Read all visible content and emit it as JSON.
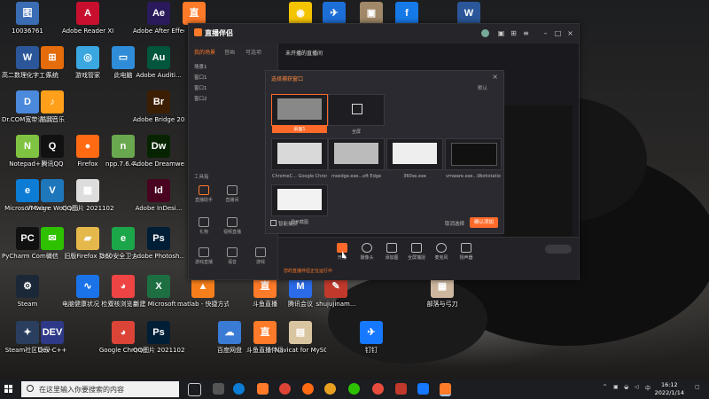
{
  "desktop_icons": [
    {
      "id": "10036761",
      "label": "10036761",
      "color": "#3b6db5",
      "glyph": "图"
    },
    {
      "id": "adobe-reader",
      "label": "Adobe Reader XI",
      "color": "#c8102e",
      "glyph": "A"
    },
    {
      "id": "after-effects",
      "label": "Adobe After Effects 2020",
      "color": "#2b1a5b",
      "glyph": "Ae"
    },
    {
      "id": "app-orange-top",
      "label": "",
      "color": "#ff7a29",
      "glyph": "直"
    },
    {
      "id": "app-yellow-top",
      "label": "",
      "color": "#f5c400",
      "glyph": "◉"
    },
    {
      "id": "app-bird-top",
      "label": "",
      "color": "#1d6fd8",
      "glyph": "✈"
    },
    {
      "id": "app-doc-top",
      "label": "",
      "color": "#a08868",
      "glyph": "▣"
    },
    {
      "id": "app-flash-top",
      "label": "",
      "color": "#1679e8",
      "glyph": "f"
    },
    {
      "id": "word-top",
      "label": "",
      "color": "#2b579a",
      "glyph": "W"
    },
    {
      "id": "word-doc",
      "label": "高二数理化字工作总结.d...",
      "color": "#2b579a",
      "glyph": "W"
    },
    {
      "id": "tool-grid",
      "label": "系统",
      "color": "#e46c0a",
      "glyph": "⊞"
    },
    {
      "id": "game-helper",
      "label": "游戏管家",
      "color": "#3aa7e0",
      "glyph": "◎"
    },
    {
      "id": "this-pc",
      "label": "此电脑",
      "color": "#2f8cd8",
      "glyph": "▭"
    },
    {
      "id": "audition",
      "label": "Adobe Auditi...",
      "color": "#00553d",
      "glyph": "Au"
    },
    {
      "id": "com-auth",
      "label": "Dr.COM宽带认证客户端",
      "color": "#4a89dc",
      "glyph": "D"
    },
    {
      "id": "music",
      "label": "酷我音乐",
      "color": "#ff9f1a",
      "glyph": "♪"
    },
    {
      "id": "bridge",
      "label": "Adobe Bridge 2020",
      "color": "#3c1e02",
      "glyph": "Br"
    },
    {
      "id": "notepadpp",
      "label": "Notepad++",
      "color": "#80c342",
      "glyph": "N"
    },
    {
      "id": "qq",
      "label": "腾讯QQ",
      "color": "#111",
      "glyph": "Q"
    },
    {
      "id": "firefox",
      "label": "Firefox",
      "color": "#ff6a13",
      "glyph": "●"
    },
    {
      "id": "npp764",
      "label": "npp.7.6.4...",
      "color": "#6aa84f",
      "glyph": "n"
    },
    {
      "id": "dreamweaver",
      "label": "Adobe Dreamwe...",
      "color": "#072401",
      "glyph": "Dw"
    },
    {
      "id": "edge",
      "label": "Microsoft Edge",
      "color": "#0c7cd5",
      "glyph": "e"
    },
    {
      "id": "vmware",
      "label": "VMware Workstati...",
      "color": "#1f77bb",
      "glyph": "V"
    },
    {
      "id": "qq-img",
      "label": "QQ图片 20211020...",
      "color": "#ddd",
      "glyph": "▦"
    },
    {
      "id": "indesign",
      "label": "Adobe InDesi...",
      "color": "#49021f",
      "glyph": "Id"
    },
    {
      "id": "pycharm",
      "label": "PyCharm Communi...",
      "color": "#111",
      "glyph": "PC"
    },
    {
      "id": "wechat",
      "label": "微信",
      "color": "#2dc100",
      "glyph": "✉"
    },
    {
      "id": "firefox-profile",
      "label": "旧版Firefox 数据",
      "color": "#e5b84c",
      "glyph": "▰"
    },
    {
      "id": "pc-manager",
      "label": "360安全卫士 ...",
      "color": "#1ca64a",
      "glyph": "e"
    },
    {
      "id": "photoshop",
      "label": "Adobe Photosh...",
      "color": "#001e36",
      "glyph": "Ps"
    },
    {
      "id": "steam",
      "label": "Steam",
      "color": "#1b2838",
      "glyph": "⚙"
    },
    {
      "id": "pc-monitor",
      "label": "电脑健康状况 检查",
      "color": "#1a73e8",
      "glyph": "∿"
    },
    {
      "id": "chrome-dual",
      "label": "双核浏览器",
      "color": "#e44",
      "glyph": "◕"
    },
    {
      "id": "excel-new",
      "label": "新建 Microsoft ...",
      "color": "#1d6f42",
      "glyph": "X"
    },
    {
      "id": "matlab",
      "label": "matlab - 快捷方式",
      "color": "#f77f1b",
      "glyph": "▲"
    },
    {
      "id": "live-app",
      "label": "斗鱼直播",
      "color": "#ff7a29",
      "glyph": "直"
    },
    {
      "id": "tencent-meeting",
      "label": "腾讯会议",
      "color": "#2b6ae8",
      "glyph": "M"
    },
    {
      "id": "shujujinam",
      "label": "shujujinam...",
      "color": "#c0392b",
      "glyph": "✎"
    },
    {
      "id": "photo-wall",
      "label": "部落与弓刀",
      "color": "#cdb79e",
      "glyph": "▦"
    },
    {
      "id": "steam-support",
      "label": "Steam社区管家",
      "color": "#2a3f5f",
      "glyph": "✦"
    },
    {
      "id": "devcpp",
      "label": "Dev-C++",
      "color": "#2e3a87",
      "glyph": "DEV"
    },
    {
      "id": "chrome",
      "label": "Google Chrome",
      "color": "#db4437",
      "glyph": "◕"
    },
    {
      "id": "qq-img2",
      "label": "QQ图片 20211020...",
      "color": "#001e36",
      "glyph": "Ps"
    },
    {
      "id": "baidu-netdisk",
      "label": "百度网盘",
      "color": "#3a7bd5",
      "glyph": "☁"
    },
    {
      "id": "douyu",
      "label": "斗鱼直播伴侣",
      "color": "#ff7a29",
      "glyph": "直"
    },
    {
      "id": "navicat",
      "label": "Navicat for MySQL",
      "color": "#d9c6a0",
      "glyph": "▤"
    },
    {
      "id": "dingding",
      "label": "钉钉",
      "color": "#1677ff",
      "glyph": "✈"
    }
  ],
  "app_window": {
    "logo": "直播伴侣",
    "tabs": [
      "我的场景",
      "音画",
      "可选项"
    ],
    "scenes": [
      "场景1",
      "窗口1",
      "窗口1",
      "窗口2"
    ],
    "tools_header": "工具箱",
    "tools": [
      "直播助手",
      "直播间",
      "礼物",
      "视频直播",
      "游戏直播",
      "语音",
      "游戏"
    ],
    "stream_title": "未开播的直播间",
    "bottom_buttons": [
      "开播",
      "摄像头",
      "添加图",
      "全屏捕捉",
      "麦克风",
      "扬声器"
    ],
    "bottom_status": "您的直播伴侣正在运行中"
  },
  "dialog": {
    "title": "选择捕获窗口",
    "sort_label": "默认",
    "items": [
      {
        "caption": "桌面1",
        "selected": true
      },
      {
        "caption": "全屏",
        "selected": false
      },
      {
        "caption": "ChromeC...  Google Chrome",
        "selected": false
      },
      {
        "caption": "msedge.exe...oft Edge",
        "selected": false
      },
      {
        "caption": "360se.exe",
        "selected": false
      },
      {
        "caption": "vmware.exe...Workstation",
        "selected": false
      },
      {
        "caption": "显示截图",
        "selected": false
      }
    ],
    "checkbox_label": "智能捕获",
    "cancel_label": "取消选择",
    "ok_label": "确认添加"
  },
  "taskbar": {
    "search_placeholder": "在这里输入你要搜索的内容",
    "time": "16:12",
    "date": "2022/1/14",
    "lang": "中"
  }
}
